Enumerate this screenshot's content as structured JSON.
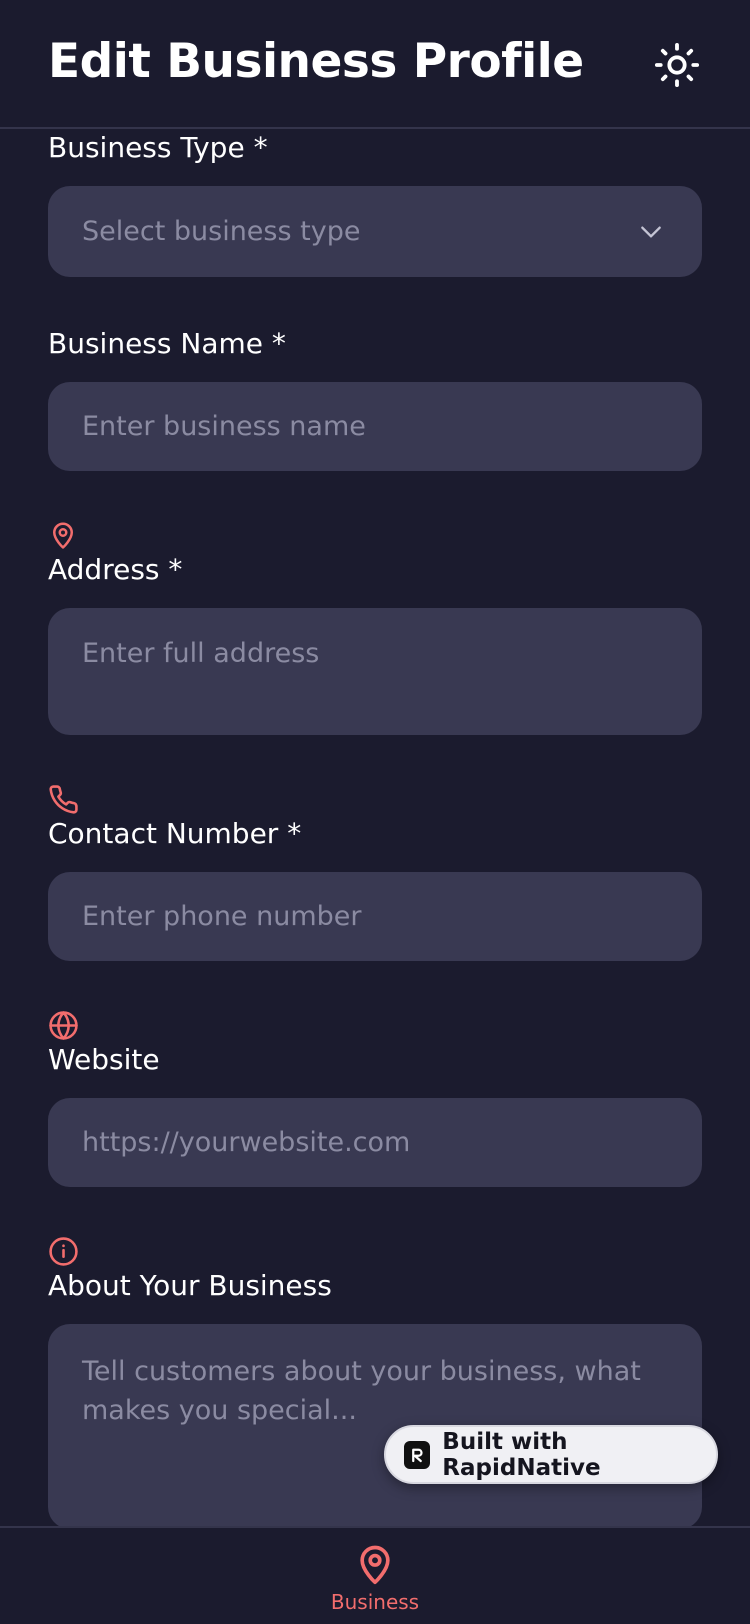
{
  "header": {
    "title": "Edit Business Profile",
    "theme_icon": "sun-icon"
  },
  "form": {
    "business_type": {
      "label": "Business Type *",
      "placeholder": "Select business type",
      "icon": "chevron-down-icon"
    },
    "business_name": {
      "label": "Business Name *",
      "placeholder": "Enter business name"
    },
    "address": {
      "label": "Address *",
      "placeholder": "Enter full address",
      "icon": "map-pin-icon"
    },
    "contact_number": {
      "label": "Contact Number *",
      "placeholder": "Enter phone number",
      "icon": "phone-icon"
    },
    "website": {
      "label": "Website",
      "placeholder": "https://yourwebsite.com",
      "icon": "globe-icon"
    },
    "about": {
      "label": "About Your Business",
      "placeholder": "Tell customers about your business, what makes you special...",
      "icon": "info-icon"
    }
  },
  "badge": {
    "label": "Built with RapidNative",
    "icon": "rapidnative-logo-icon"
  },
  "tabbar": {
    "items": [
      {
        "label": "Business",
        "icon": "map-pin-icon",
        "active": true
      }
    ]
  },
  "colors": {
    "background": "#1b1b2e",
    "field": "#393952",
    "placeholder": "#8b8ba2",
    "accent": "#f26d6d",
    "text": "#ffffff"
  }
}
